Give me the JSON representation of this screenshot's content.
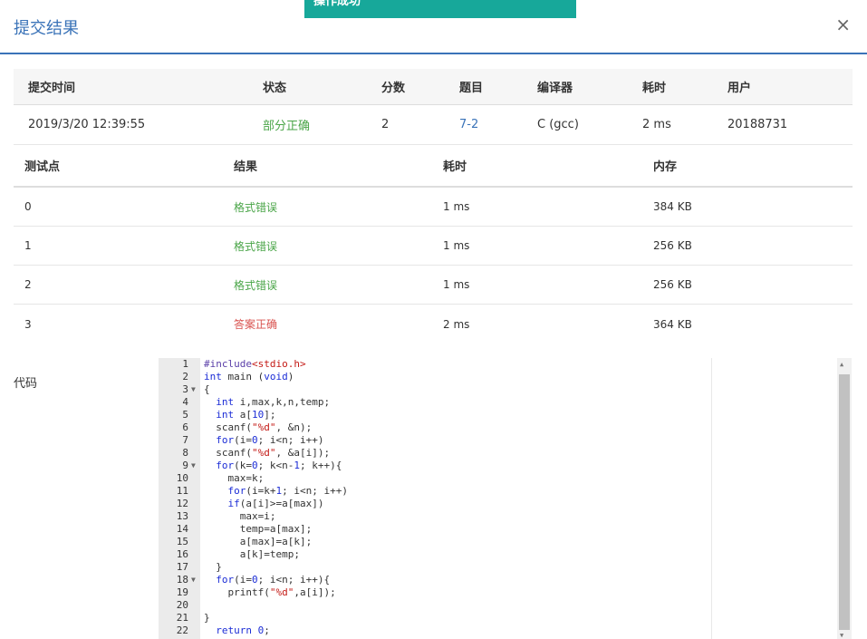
{
  "toast": {
    "text": "操作成功"
  },
  "header": {
    "title": "提交结果",
    "close": "×"
  },
  "summary": {
    "headers": [
      "提交时间",
      "状态",
      "分数",
      "题目",
      "编译器",
      "耗时",
      "用户"
    ],
    "row": [
      "2019/3/20 12:39:55",
      "部分正确",
      "2",
      "7-2",
      "C (gcc)",
      "2 ms",
      "20188731"
    ]
  },
  "tests": {
    "headers": [
      "测试点",
      "结果",
      "耗时",
      "内存"
    ],
    "rows": [
      [
        "0",
        "格式错误",
        "1 ms",
        "384 KB"
      ],
      [
        "1",
        "格式错误",
        "1 ms",
        "256 KB"
      ],
      [
        "2",
        "格式错误",
        "1 ms",
        "256 KB"
      ],
      [
        "3",
        "答案正确",
        "2 ms",
        "364 KB"
      ]
    ]
  },
  "code": {
    "label": "代码",
    "lines": [
      "#include<stdio.h>",
      "int main (void)",
      "{",
      "  int i,max,k,n,temp;",
      "  int a[10];",
      "  scanf(\"%d\", &n);",
      "  for(i=0; i<n; i++)",
      "  scanf(\"%d\", &a[i]);",
      "  for(k=0; k<n-1; k++){",
      "    max=k;",
      "    for(i=k+1; i<n; i++)",
      "    if(a[i]>=a[max])",
      "      max=i;",
      "      temp=a[max];",
      "      a[max]=a[k];",
      "      a[k]=temp;",
      "  }",
      "  for(i=0; i<n; i++){",
      "    printf(\"%d\",a[i]);",
      "",
      "}",
      "  return 0;"
    ],
    "folds": [
      3,
      9,
      18
    ]
  },
  "colors": {
    "accent": "#3a73b8",
    "toast": "#17a89a",
    "partial": "#4aa548",
    "correct": "#d9534f"
  }
}
